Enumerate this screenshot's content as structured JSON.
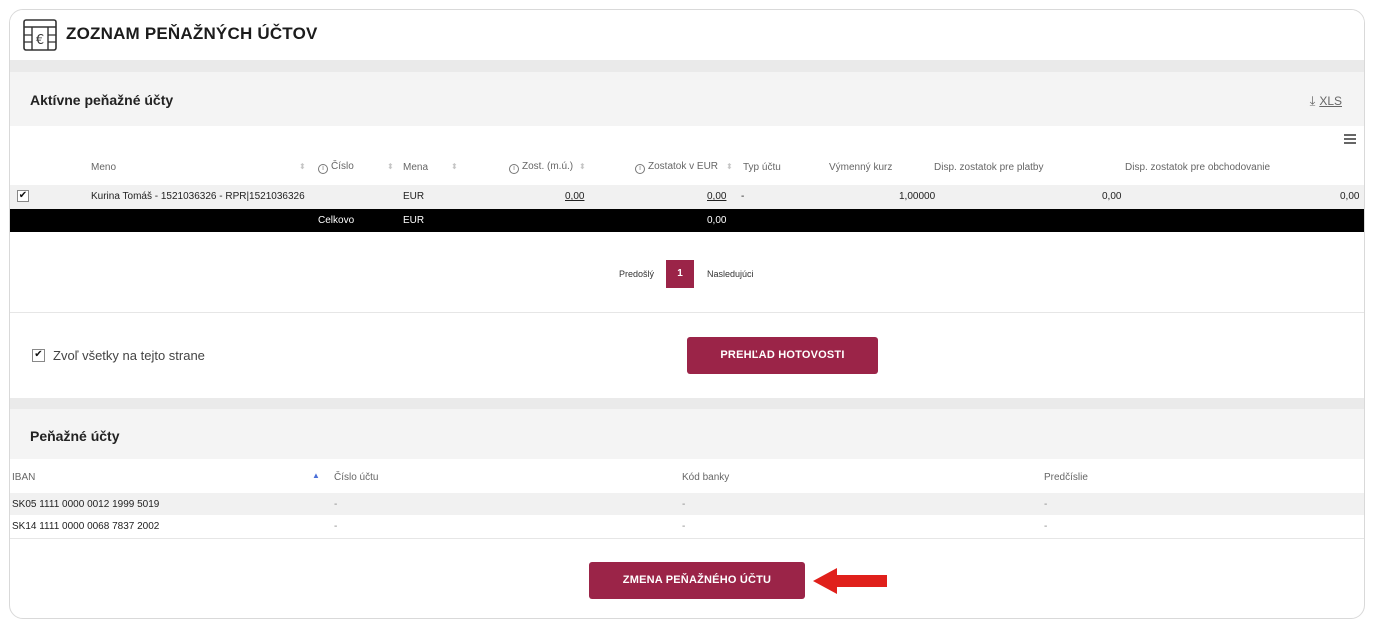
{
  "header": {
    "title": "ZOZNAM PEŇAŽNÝCH ÚČTOV",
    "logo_icon": "euro-wallet-icon"
  },
  "active_accounts": {
    "title": "Aktívne peňažné účty",
    "export_label": "XLS",
    "columns": [
      "Meno",
      "Číslo",
      "Mena",
      "Zost. (m.ú.)",
      "Zostatok v EUR",
      "Typ účtu",
      "Výmenný kurz",
      "Disp. zostatok pre platby",
      "Disp. zostatok pre obchodovanie"
    ],
    "rows": [
      {
        "checked": true,
        "meno": "Kurina Tomáš - 1521036326 - RPR|1521036326",
        "mena": "EUR",
        "zost_mu": "0,00",
        "zost_eur": "0,00",
        "typ": "-",
        "kurz": "1,00000",
        "disp_platby": "0,00",
        "disp_obchod": "0,00"
      }
    ],
    "total": {
      "label": "Celkovo",
      "mena": "EUR",
      "zost_eur": "0,00"
    },
    "pagination": {
      "prev": "Predošlý",
      "current": "1",
      "next": "Nasledujúci"
    },
    "select_all_label": "Zvoľ všetky na tejto strane",
    "select_all_checked": true,
    "overview_button": "PREHĽAD HOTOVOSTI"
  },
  "cash_accounts": {
    "title": "Peňažné účty",
    "columns": [
      "IBAN",
      "Číslo účtu",
      "Kód banky",
      "Predčíslie"
    ],
    "rows": [
      {
        "iban": "SK05 1111 0000 0012 1999 5019",
        "cislo": "-",
        "kod": "-",
        "predcislie": "-"
      },
      {
        "iban": "SK14 1111 0000 0068 7837 2002",
        "cislo": "-",
        "kod": "-",
        "predcislie": "-"
      }
    ],
    "change_button": "ZMENA PEŇAŽNÉHO ÚČTU"
  },
  "colors": {
    "accent": "#9b2448",
    "total_row": "#000000",
    "arrow": "#e0201b"
  }
}
